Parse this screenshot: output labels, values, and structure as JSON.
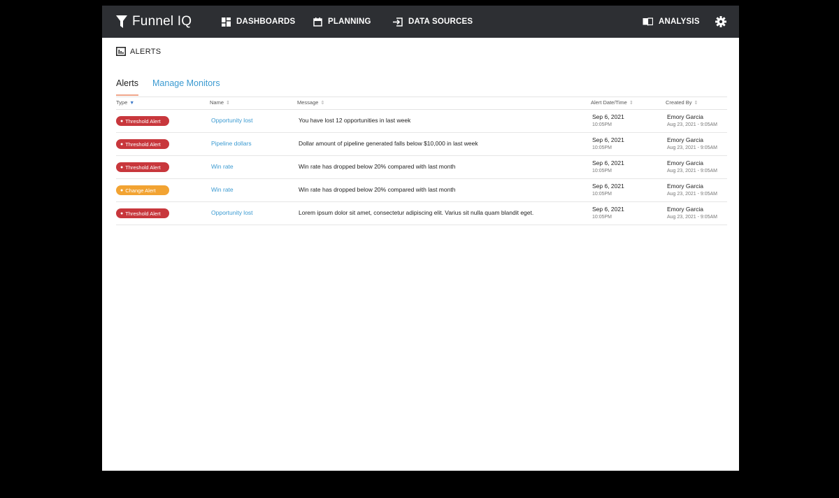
{
  "colors": {
    "nav_bg": "#2d2f33",
    "link": "#3b9ad1",
    "threshold": "#c8373c",
    "change": "#f2a332",
    "tab_indicator": "#f0a58a"
  },
  "navbar": {
    "brand": "Funnel IQ",
    "brand_icon": "funnel-icon",
    "items": [
      {
        "label": "DASHBOARDS",
        "icon": "dashboard-grid-icon"
      },
      {
        "label": "PLANNING",
        "icon": "calendar-icon"
      },
      {
        "label": "DATA SOURCES",
        "icon": "import-icon"
      },
      {
        "label": "ANALYSIS",
        "icon": "book-icon"
      }
    ],
    "settings_icon": "gear-icon"
  },
  "page": {
    "title": "ALERTS",
    "title_icon": "bar-chart-icon"
  },
  "tabs": [
    {
      "label": "Alerts",
      "active": true
    },
    {
      "label": "Manage Monitors",
      "active": false
    }
  ],
  "table": {
    "columns": [
      {
        "label": "Type",
        "sort": "desc"
      },
      {
        "label": "Name",
        "sort": "none"
      },
      {
        "label": "Message",
        "sort": "none"
      },
      {
        "label": "Alert Date/Time",
        "sort": "none"
      },
      {
        "label": "Created By",
        "sort": "none"
      }
    ],
    "rows": [
      {
        "type": "Threshold Alert",
        "kind": "threshold",
        "name": "Opportunity lost",
        "message": "You have lost 12 opportunities in last week",
        "date": "Sep 6, 2021",
        "time": "10:05PM",
        "creator": "Emory Garcia",
        "created": "Aug 23, 2021 - 9:05AM"
      },
      {
        "type": "Threshold Alert",
        "kind": "threshold",
        "name": "Pipeline dollars",
        "message": "Dollar amount of pipeline generated falls below $10,000 in last week",
        "date": "Sep 6, 2021",
        "time": "10:05PM",
        "creator": "Emory Garcia",
        "created": "Aug 23, 2021 - 9:05AM"
      },
      {
        "type": "Threshold Alert",
        "kind": "threshold",
        "name": "Win rate",
        "message": "Win rate has dropped below 20% compared with last month",
        "date": "Sep 6, 2021",
        "time": "10:05PM",
        "creator": "Emory Garcia",
        "created": "Aug 23, 2021 - 9:05AM"
      },
      {
        "type": "Change Alert",
        "kind": "change",
        "name": "Win rate",
        "message": "Win rate has dropped below 20% compared with last month",
        "date": "Sep 6, 2021",
        "time": "10:05PM",
        "creator": "Emory Garcia",
        "created": "Aug 23, 2021 - 9:05AM"
      },
      {
        "type": "Threshold Alert",
        "kind": "threshold",
        "name": "Opportunity lost",
        "message": "Lorem ipsum dolor sit amet, consectetur adipiscing elit. Varius sit nulla quam blandit eget.",
        "date": "Sep 6, 2021",
        "time": "10:05PM",
        "creator": "Emory Garcia",
        "created": "Aug 23, 2021 - 9:05AM"
      }
    ]
  }
}
